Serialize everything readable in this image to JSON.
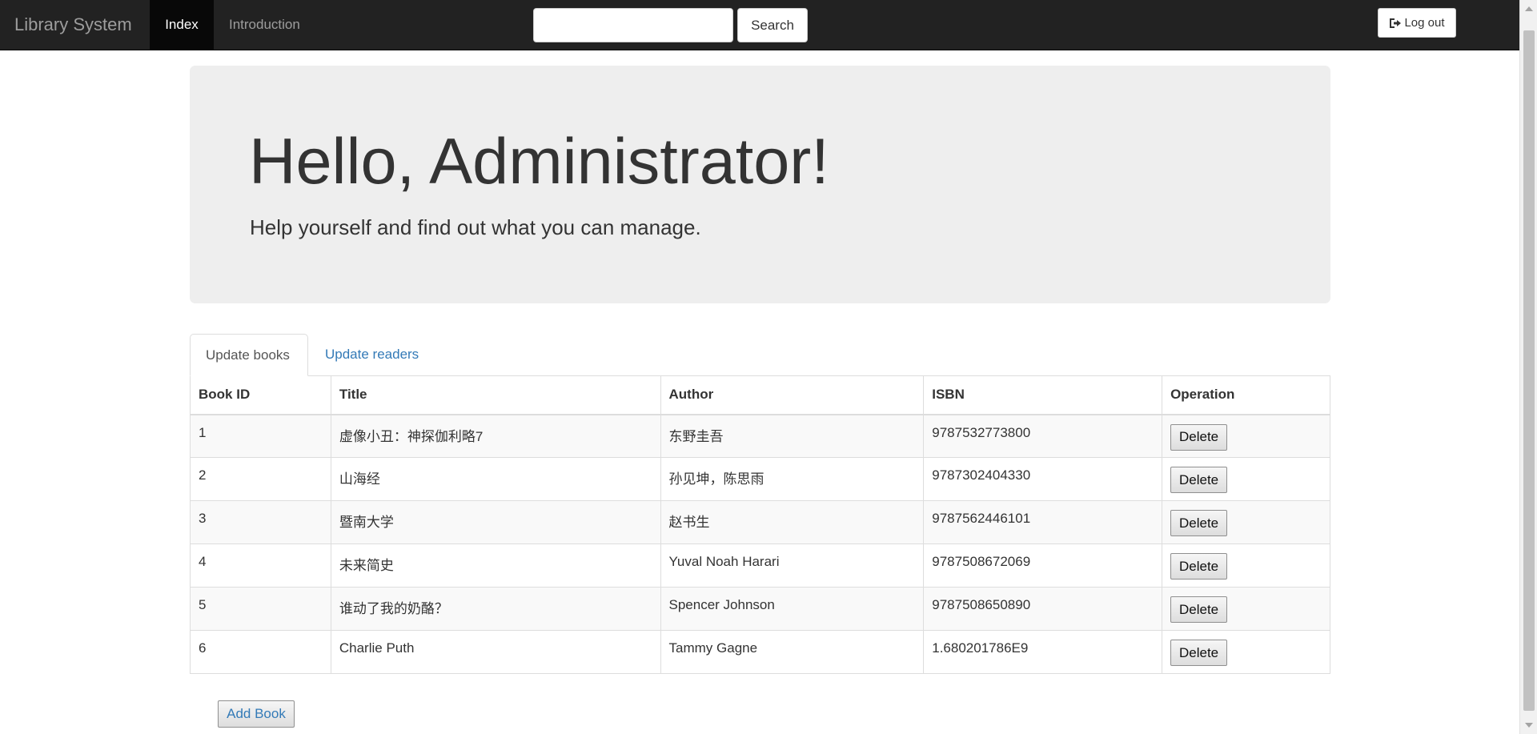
{
  "navbar": {
    "brand": "Library System",
    "items": [
      {
        "label": "Index",
        "active": true
      },
      {
        "label": "Introduction",
        "active": false
      }
    ],
    "search": {
      "value": "",
      "placeholder": "",
      "button_label": "Search"
    },
    "logout": {
      "label": "Log out",
      "icon": "log-out-icon"
    },
    "colors": {
      "background": "#222222",
      "active_item": "#080808",
      "text": "#9d9d9d"
    }
  },
  "jumbotron": {
    "title": "Hello, Administrator!",
    "subtitle": "Help yourself and find out what you can manage.",
    "background": "#eeeeee"
  },
  "tabs": [
    {
      "label": "Update books",
      "active": true
    },
    {
      "label": "Update readers",
      "active": false
    }
  ],
  "table": {
    "headers": [
      "Book ID",
      "Title",
      "Author",
      "ISBN",
      "Operation"
    ],
    "rows": [
      {
        "id": "1",
        "title": "虚像小丑：神探伽利略7",
        "author": "东野圭吾",
        "isbn": "9787532773800",
        "action": "Delete"
      },
      {
        "id": "2",
        "title": "山海经",
        "author": "孙见坤，陈思雨",
        "isbn": "9787302404330",
        "action": "Delete"
      },
      {
        "id": "3",
        "title": "暨南大学",
        "author": "赵书生",
        "isbn": "9787562446101",
        "action": "Delete"
      },
      {
        "id": "4",
        "title": "未来简史",
        "author": "Yuval Noah Harari",
        "isbn": "9787508672069",
        "action": "Delete"
      },
      {
        "id": "5",
        "title": "谁动了我的奶酪？",
        "author": "Spencer Johnson",
        "isbn": "9787508650890",
        "action": "Delete"
      },
      {
        "id": "6",
        "title": "Charlie Puth",
        "author": "Tammy Gagne",
        "isbn": "1.680201786E9",
        "action": "Delete"
      }
    ]
  },
  "add_book": {
    "label": "Add Book",
    "color": "#337ab7"
  },
  "link_color": "#337ab7"
}
